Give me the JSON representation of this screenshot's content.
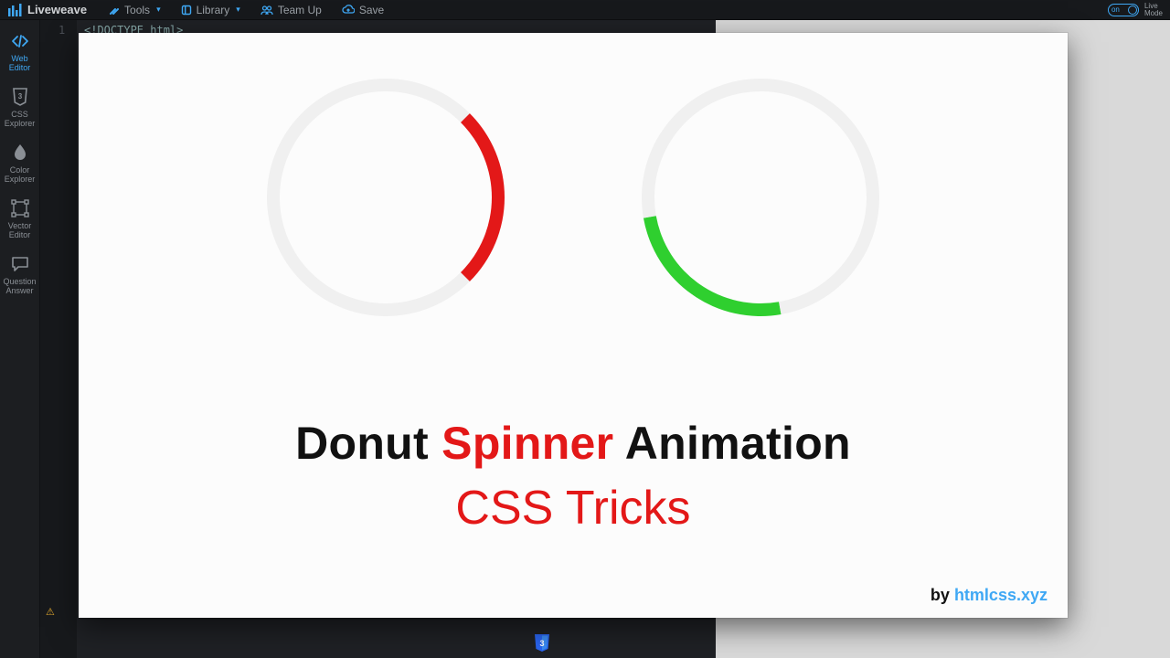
{
  "brand": "Liveweave",
  "menu": {
    "tools": "Tools",
    "library": "Library",
    "team": "Team Up",
    "save": "Save"
  },
  "livemode": {
    "on": "on",
    "label1": "Live",
    "label2": "Mode"
  },
  "sidebar": {
    "items": [
      {
        "label1": "Web",
        "label2": "Editor"
      },
      {
        "label1": "CSS",
        "label2": "Explorer"
      },
      {
        "label1": "Color",
        "label2": "Explorer"
      },
      {
        "label1": "Vector",
        "label2": "Editor"
      },
      {
        "label1": "Question",
        "label2": "Answer"
      }
    ]
  },
  "editor": {
    "line_no": "1",
    "line_text": "<!DOCTYPE html>"
  },
  "card": {
    "title_pre": "Donut ",
    "title_accent": "Spinner",
    "title_post": " Animation",
    "subtitle": "CSS Tricks",
    "by": "by ",
    "site": "htmlcss.xyz"
  }
}
